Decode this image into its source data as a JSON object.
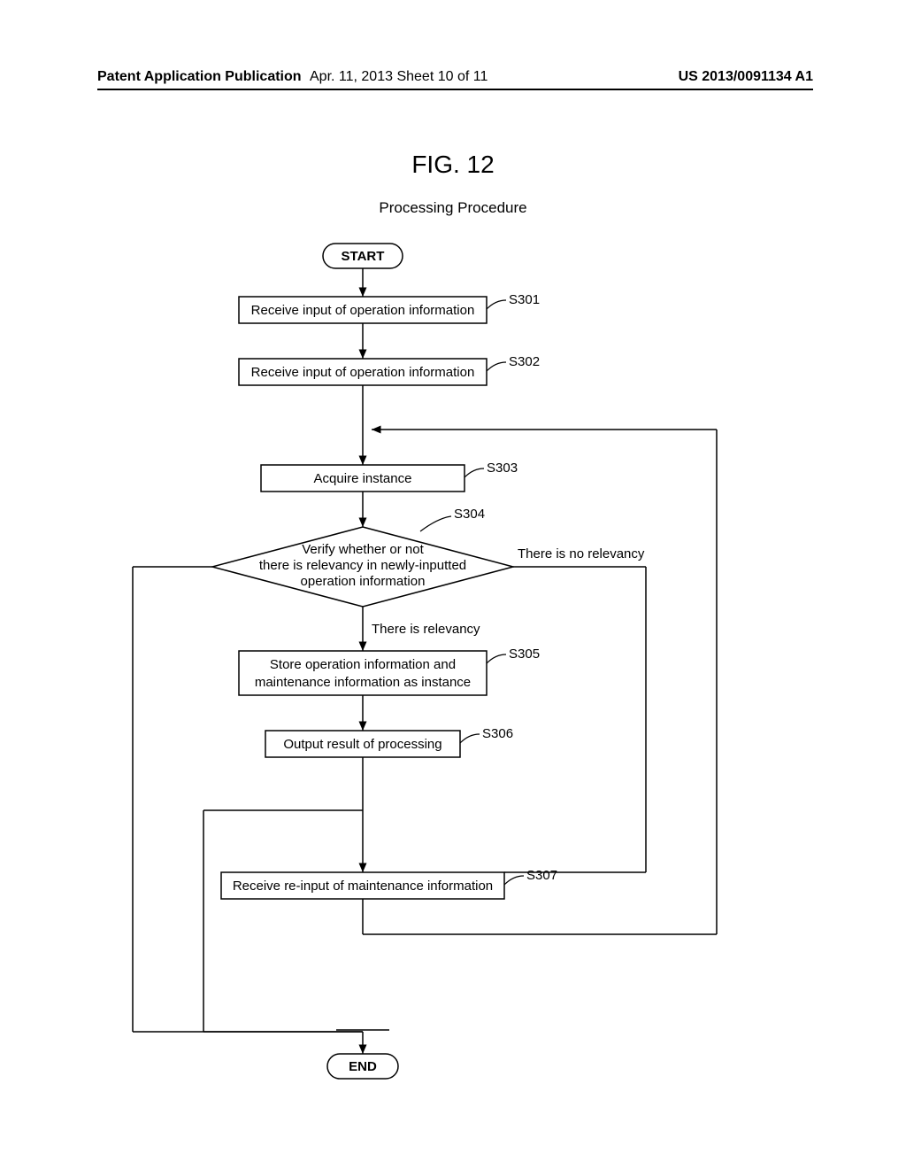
{
  "header": {
    "left": "Patent Application Publication",
    "mid": "Apr. 11, 2013  Sheet 10 of 11",
    "right": "US 2013/0091134 A1"
  },
  "figure": {
    "title": "FIG. 12",
    "subtitle": "Processing Procedure"
  },
  "chart_data": {
    "type": "flowchart",
    "nodes": [
      {
        "id": "start",
        "kind": "terminator",
        "label": "START"
      },
      {
        "id": "s301",
        "kind": "process",
        "label": "Receive input of operation information",
        "tag": "S301"
      },
      {
        "id": "s302",
        "kind": "process",
        "label": "Receive input of operation information",
        "tag": "S302"
      },
      {
        "id": "s303",
        "kind": "process",
        "label": "Acquire instance",
        "tag": "S303"
      },
      {
        "id": "s304",
        "kind": "decision",
        "label": "Verify whether or not there is relevancy in newly-inputted operation information",
        "tag": "S304"
      },
      {
        "id": "s305",
        "kind": "process",
        "label": "Store operation information and maintenance information as instance",
        "tag": "S305"
      },
      {
        "id": "s306",
        "kind": "process",
        "label": "Output result of processing",
        "tag": "S306"
      },
      {
        "id": "s307",
        "kind": "process",
        "label": "Receive re-input of maintenance information",
        "tag": "S307"
      },
      {
        "id": "end",
        "kind": "terminator",
        "label": "END"
      }
    ],
    "edge_labels": {
      "s304_yes": "There is relevancy",
      "s304_no": "There is no relevancy"
    },
    "edges": [
      [
        "start",
        "s301"
      ],
      [
        "s301",
        "s302"
      ],
      [
        "s302",
        "s303"
      ],
      [
        "s303",
        "s304"
      ],
      [
        "s304",
        "s305",
        "yes"
      ],
      [
        "s305",
        "s306"
      ],
      [
        "s306",
        "end"
      ],
      [
        "s304",
        "s307",
        "no"
      ],
      [
        "s307",
        "s303",
        "loop"
      ],
      [
        "s304",
        "end",
        "left-exit"
      ]
    ]
  }
}
